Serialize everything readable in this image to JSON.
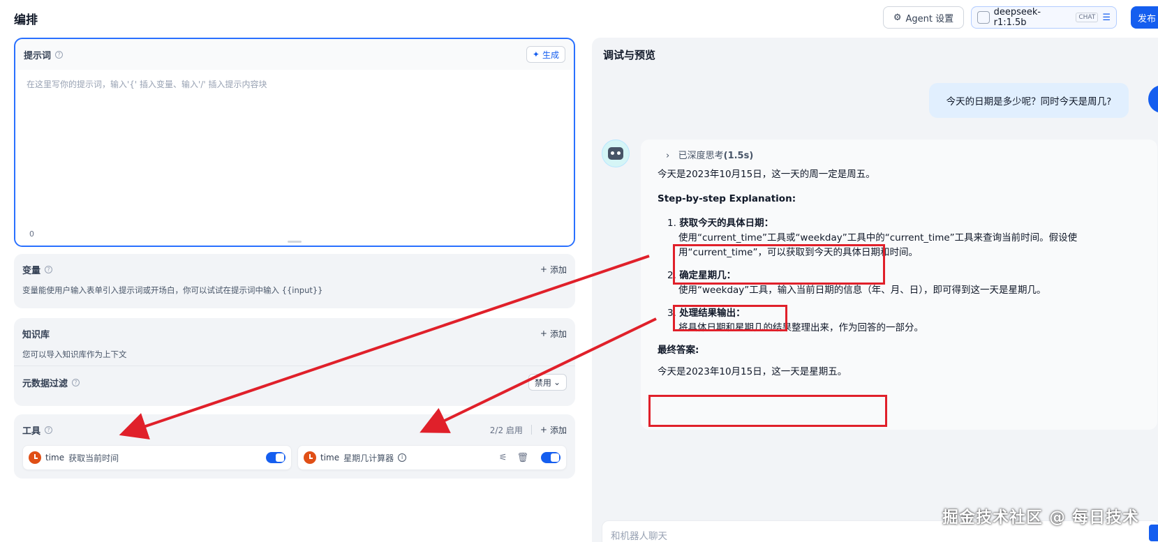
{
  "header": {
    "title": "编排",
    "agent_settings_label": "Agent 设置",
    "model_name": "deepseek-r1:1.5b",
    "model_mode": "CHAT",
    "publish_label": "发布"
  },
  "prompt": {
    "title": "提示词",
    "generate_label": "生成",
    "placeholder": "在这里写你的提示词，输入'{' 插入变量、输入'/' 插入提示内容块",
    "char_count": "0"
  },
  "variables": {
    "title": "变量",
    "add_label": "添加",
    "description": "变量能使用户输入表单引入提示词或开场白，你可以试试在提示词中输入 {{input}}"
  },
  "knowledge": {
    "title": "知识库",
    "add_label": "添加",
    "description": "您可以导入知识库作为上下文",
    "metadata_filter_label": "元数据过滤",
    "metadata_filter_value": "禁用"
  },
  "tools": {
    "title": "工具",
    "enabled_count": "2/2 启用",
    "add_label": "添加",
    "items": [
      {
        "provider": "time",
        "name": "获取当前时间",
        "enabled": true
      },
      {
        "provider": "time",
        "name": "星期几计算器",
        "enabled": true
      }
    ]
  },
  "preview": {
    "title": "调试与预览",
    "user_message": "今天的日期是多少呢？同时今天是周几?",
    "thinking_label": "已深度思考",
    "thinking_time": "(1.5s)",
    "answer_intro": "今天是2023年10月15日，这一天的周一定是周五。",
    "explanation_heading": "Step-by-step Explanation:",
    "steps": [
      {
        "num": "1.",
        "title": "获取今天的具体日期：",
        "body": "使用“current_time”工具或“weekday”工具中的“current_time”工具来查询当前时间。假设使用“current_time”，可以获取到今天的具体日期和时间。"
      },
      {
        "num": "2.",
        "title": "确定星期几：",
        "body": "使用“weekday”工具，输入当前日期的信息（年、月、日），即可得到这一天是星期几。"
      },
      {
        "num": "3.",
        "title": "处理结果输出：",
        "body": "将具体日期和星期几的结果整理出来，作为回答的一部分。"
      }
    ],
    "final_heading": "最终答案:",
    "final_answer": "今天是2023年10月15日，这一天是星期五。",
    "input_placeholder": "和机器人聊天"
  },
  "watermark": "掘金技术社区 @ 每日技术",
  "colors": {
    "accent": "#155eef",
    "annotation": "#e0202a",
    "tool_icon": "#e04f16"
  }
}
